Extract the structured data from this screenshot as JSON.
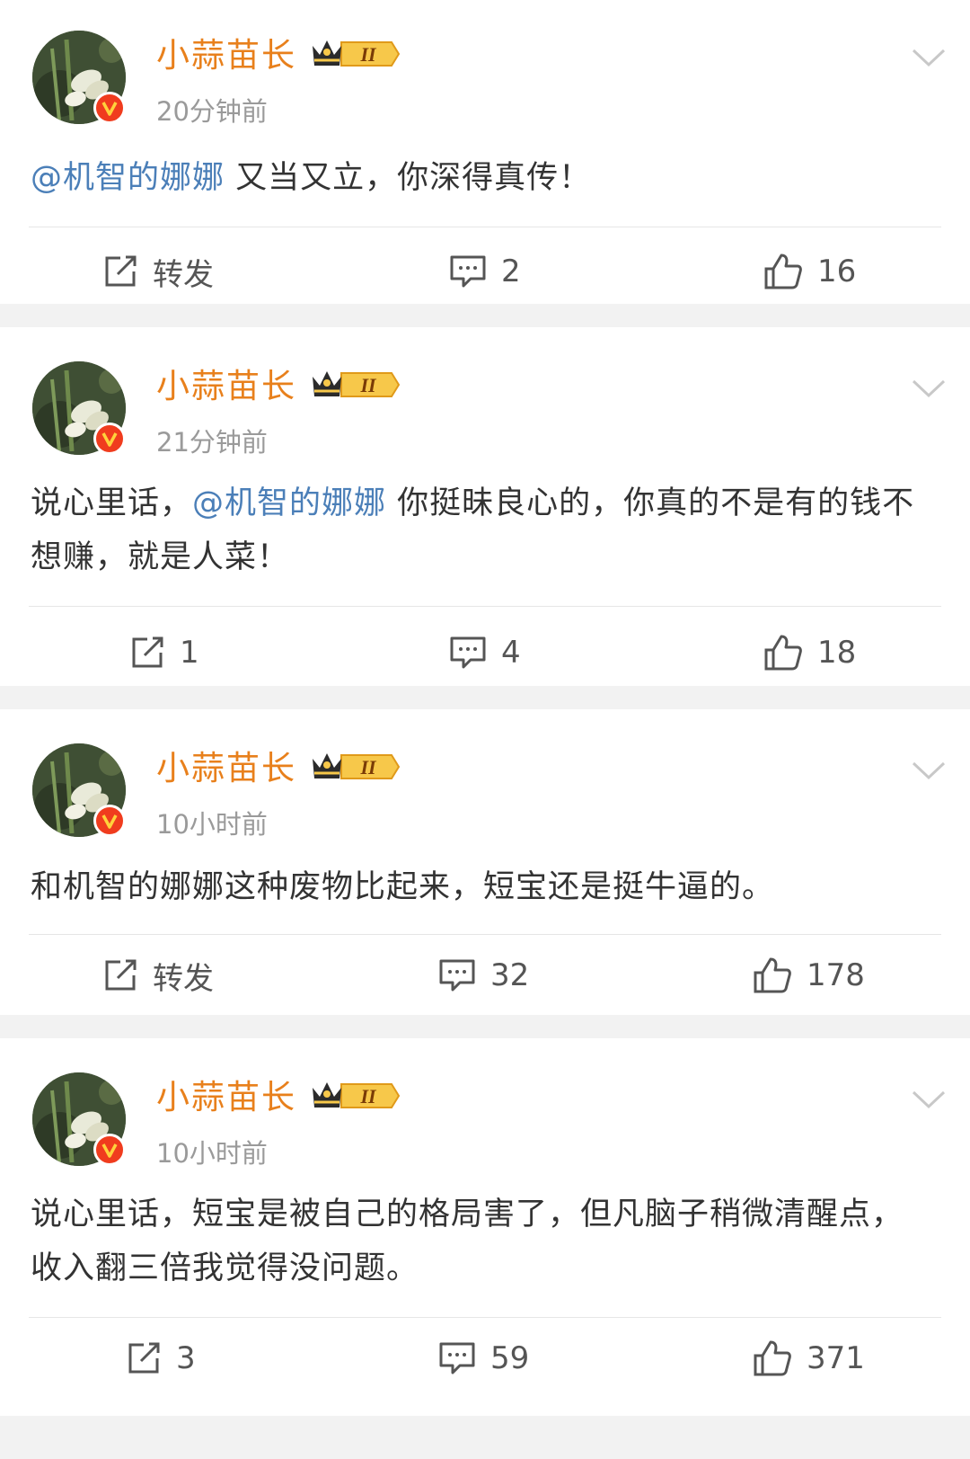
{
  "posts": [
    {
      "user": "小蒜苗长",
      "time": "20分钟前",
      "content_parts": [
        {
          "text": "@机智的娜娜",
          "mention": true
        },
        {
          "text": " 又当又立，你深得真传！",
          "mention": false
        }
      ],
      "repost_label": "转发",
      "comments": "2",
      "likes": "16"
    },
    {
      "user": "小蒜苗长",
      "time": "21分钟前",
      "content_parts": [
        {
          "text": "说心里话，",
          "mention": false
        },
        {
          "text": "@机智的娜娜",
          "mention": true
        },
        {
          "text": " 你挺昧良心的，你真的不是有的钱不想赚，就是人菜！",
          "mention": false
        }
      ],
      "repost_label": "1",
      "comments": "4",
      "likes": "18"
    },
    {
      "user": "小蒜苗长",
      "time": "10小时前",
      "content_parts": [
        {
          "text": "和机智的娜娜这种废物比起来，短宝还是挺牛逼的。",
          "mention": false
        }
      ],
      "repost_label": "转发",
      "comments": "32",
      "likes": "178"
    },
    {
      "user": "小蒜苗长",
      "time": "10小时前",
      "content_parts": [
        {
          "text": "说心里话，短宝是被自己的格局害了，但凡脑子稍微清醒点，收入翻三倍我觉得没问题。",
          "mention": false
        }
      ],
      "repost_label": "3",
      "comments": "59",
      "likes": "371"
    }
  ],
  "badge": {
    "level_text": "II",
    "verified_mark": "V"
  },
  "icons": {
    "repost": "repost-icon",
    "comment": "comment-icon",
    "like": "like-icon",
    "more": "chevron-down-icon"
  },
  "colors": {
    "username": "#e8801c",
    "mention": "#4b7fb8",
    "verified": "#f03c1e",
    "time": "#9a9a9a",
    "background": "#f2f2f2"
  }
}
